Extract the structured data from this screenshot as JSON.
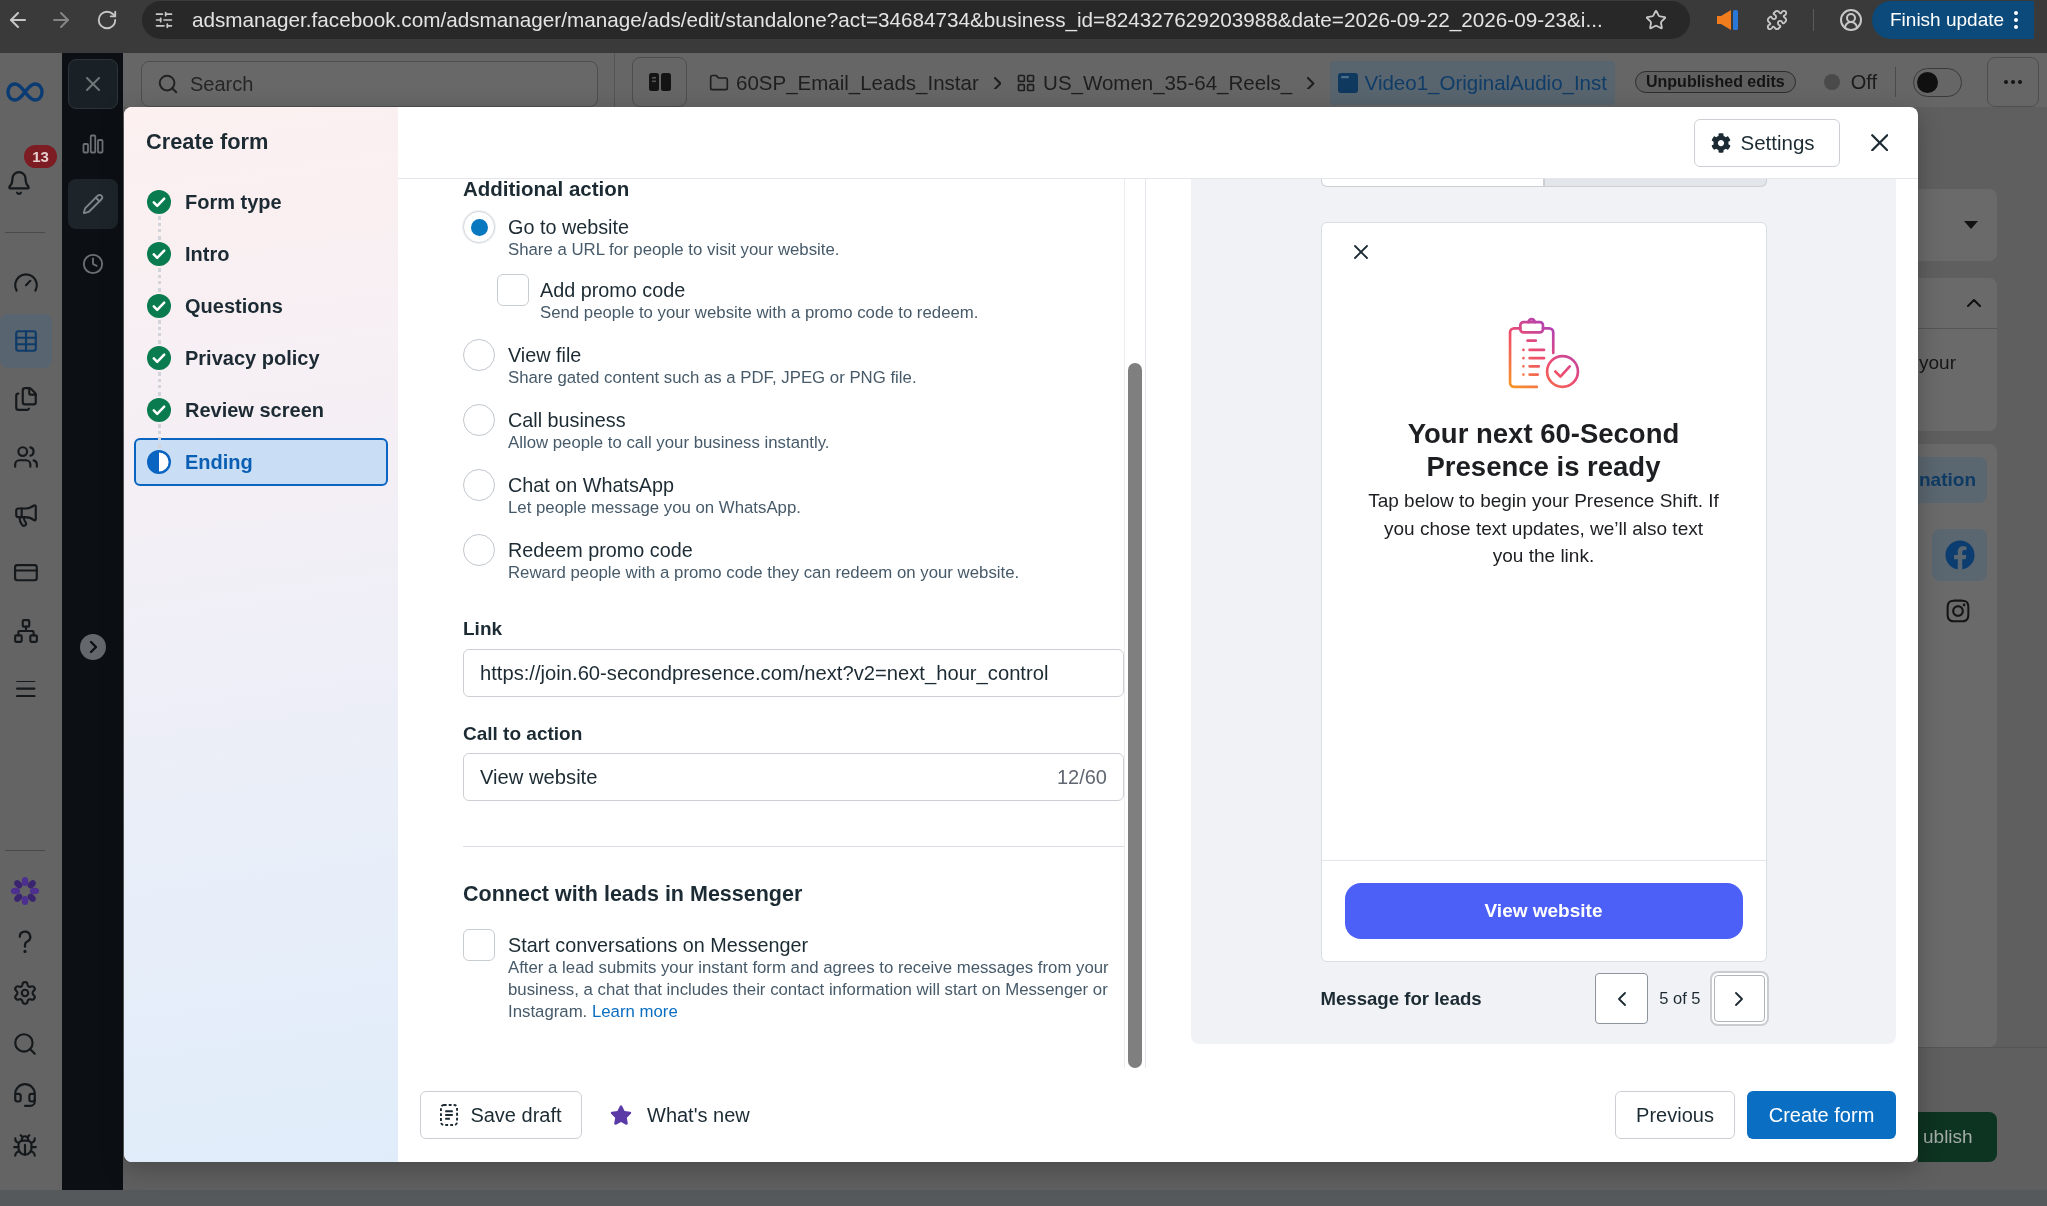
{
  "browser": {
    "nav_buttons": [
      {
        "kind": "back",
        "disabled": false
      },
      {
        "kind": "forward",
        "disabled": true
      },
      {
        "kind": "reload",
        "disabled": false
      }
    ],
    "url": "adsmanager.facebook.com/adsmanager/manage/ads/edit/standalone?act=34684734&business_id=824327629203988&date=2026-09-22_2026-09-23&i...",
    "update_button": "Finish update"
  },
  "nav_rail": {
    "notification_count": "13",
    "items": [
      {
        "kind": "gauge",
        "selected": false
      },
      {
        "kind": "table",
        "selected": true
      },
      {
        "kind": "pages",
        "selected": false
      },
      {
        "kind": "people",
        "selected": false
      },
      {
        "kind": "megaphone",
        "selected": false
      },
      {
        "kind": "card",
        "selected": false
      },
      {
        "kind": "network",
        "selected": false
      },
      {
        "kind": "menu",
        "selected": false
      }
    ],
    "bottom_items": [
      {
        "kind": "flower"
      },
      {
        "kind": "help"
      },
      {
        "kind": "settings"
      },
      {
        "kind": "search"
      },
      {
        "kind": "headset"
      },
      {
        "kind": "bug"
      }
    ]
  },
  "tool_rail": {
    "items": [
      {
        "kind": "chart",
        "selected": false
      },
      {
        "kind": "edit",
        "selected": true
      },
      {
        "kind": "history",
        "selected": false
      }
    ]
  },
  "app_header": {
    "search": {
      "placeholder": "Search"
    },
    "breadcrumbs": [
      {
        "kind": "folder",
        "label": "60SP_Email_Leads_Instar",
        "selected": false
      },
      {
        "kind": "grid",
        "label": "US_Women_35-64_Reels_",
        "selected": false
      },
      {
        "kind": "square",
        "label": "Video1_OriginalAudio_Inst",
        "selected": true
      }
    ],
    "badge": "Unpublished edits",
    "status": {
      "label": "Off",
      "on": false
    }
  },
  "background_panel": {
    "card_text": "your",
    "tab_label": "nation",
    "publish_button": "ublish"
  },
  "dialog": {
    "title": "Create form",
    "steps": [
      {
        "label": "Form type",
        "done": true,
        "selected": false
      },
      {
        "label": "Intro",
        "done": true,
        "selected": false
      },
      {
        "label": "Questions",
        "done": true,
        "selected": false
      },
      {
        "label": "Privacy policy",
        "done": true,
        "selected": false
      },
      {
        "label": "Review screen",
        "done": true,
        "selected": false
      },
      {
        "label": "Ending",
        "done": false,
        "selected": true
      }
    ],
    "settings_button": "Settings",
    "form": {
      "additional_action": {
        "title": "Additional action",
        "options": [
          {
            "label": "Go to website",
            "description": "Share a URL for people to visit your website.",
            "selected": true,
            "sub_options": [
              {
                "label": "Add promo code",
                "description": "Send people to your website with a promo code to redeem.",
                "checked": false
              }
            ]
          },
          {
            "label": "View file",
            "description": "Share gated content such as a PDF, JPEG or PNG file.",
            "selected": false
          },
          {
            "label": "Call business",
            "description": "Allow people to call your business instantly.",
            "selected": false
          },
          {
            "label": "Chat on WhatsApp",
            "description": "Let people message you on WhatsApp.",
            "selected": false
          },
          {
            "label": "Redeem promo code",
            "description": "Reward people with a promo code they can redeem on your website.",
            "selected": false
          }
        ]
      },
      "fields": [
        {
          "label": "Link",
          "value": "https://join.60-secondpresence.com/next?v2=next_hour_control"
        },
        {
          "label": "Call to action",
          "value": "View website",
          "counter": "12/60"
        }
      ],
      "messenger": {
        "title": "Connect with leads in Messenger",
        "option": {
          "label": "Start conversations on Messenger",
          "description": "After a lead submits your instant form and agrees to receive messages from your business, a chat that includes their contact information will start on Messenger or Instagram.",
          "link": "Learn more",
          "checked": false
        }
      }
    },
    "preview": {
      "tabs": [
        {
          "selected": true
        },
        {
          "selected": false
        }
      ],
      "card": {
        "title": "Your next 60-Second Presence is ready",
        "body": "Tap below to begin your Presence Shift. If you chose text updates, we’ll also text you the link.",
        "button": "View website"
      },
      "caption": "Message for leads",
      "pager": {
        "label": "5 of 5",
        "buttons": [
          {
            "kind": "previous",
            "focused": false
          },
          {
            "kind": "next",
            "focused": true
          }
        ]
      }
    },
    "footer": {
      "save_draft": "Save draft",
      "whats_new": "What's new",
      "previous": "Previous",
      "create": "Create form"
    }
  }
}
